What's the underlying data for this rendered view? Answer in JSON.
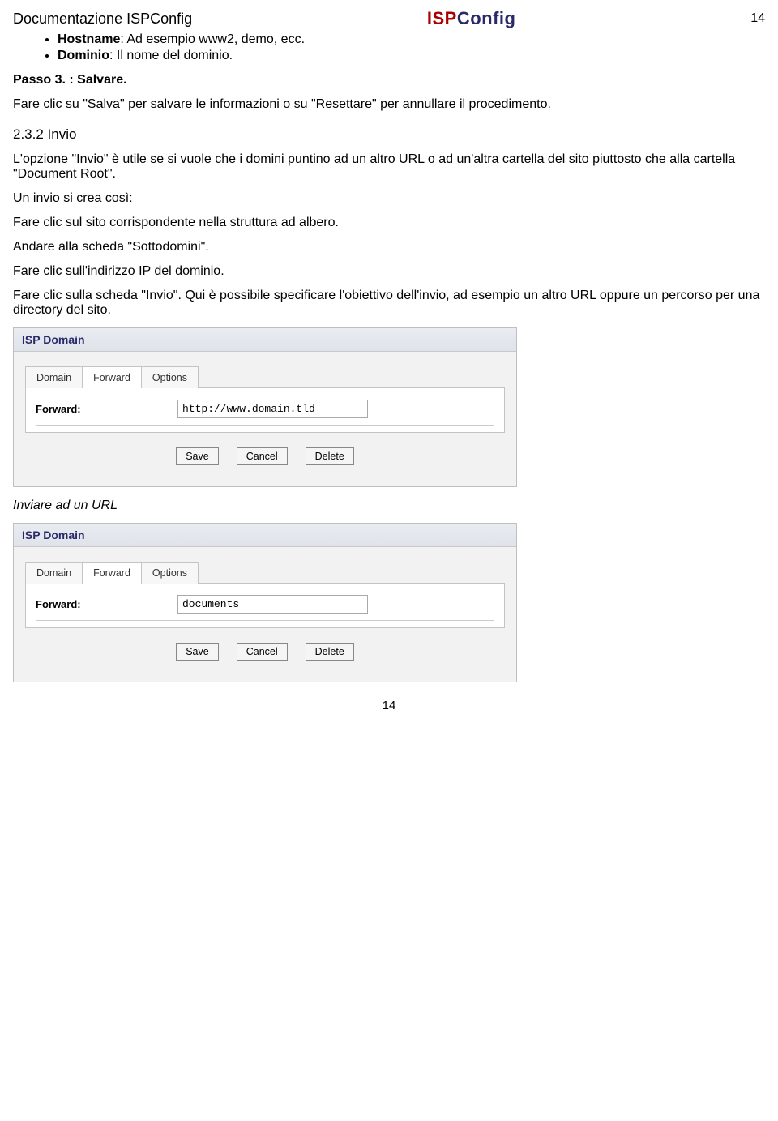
{
  "header": {
    "doc_title": "Documentazione ISPConfig",
    "logo_isp": "ISP",
    "logo_config": "Config",
    "page_num_top": "14"
  },
  "bullets": {
    "hostname_label": "Hostname",
    "hostname_text": ": Ad esempio www2, demo, ecc.",
    "dominio_label": "Dominio",
    "dominio_text": ": Il nome del dominio."
  },
  "passo3": {
    "title": "Passo 3. : Salvare.",
    "text": "Fare clic su \"Salva\" per salvare le informazioni o su \"Resettare\" per annullare il procedimento."
  },
  "section232": {
    "heading": "2.3.2 Invio",
    "p1": "L'opzione \"Invio\" è utile se si vuole che i domini puntino ad un altro URL o ad un'altra cartella del sito piuttosto che alla cartella \"Document Root\".",
    "p2": "Un invio si crea così:",
    "p3": "Fare clic sul sito corrispondente nella struttura ad albero.",
    "p4": "Andare alla scheda \"Sottodomini\".",
    "p5": "Fare clic sull'indirizzo IP del dominio.",
    "p6": "Fare clic sulla scheda \"Invio\". Qui è possibile specificare l'obiettivo dell'invio, ad esempio un altro URL oppure un percorso per una directory del sito."
  },
  "panel": {
    "title": "ISP Domain",
    "tabs": [
      "Domain",
      "Forward",
      "Options"
    ],
    "forward_label": "Forward:",
    "save": "Save",
    "cancel": "Cancel",
    "delete": "Delete"
  },
  "screenshot1": {
    "forward_value": "http://www.domain.tld"
  },
  "caption1": "Inviare ad un URL",
  "screenshot2": {
    "forward_value": "documents"
  },
  "footer": {
    "page_num_bottom": "14"
  }
}
